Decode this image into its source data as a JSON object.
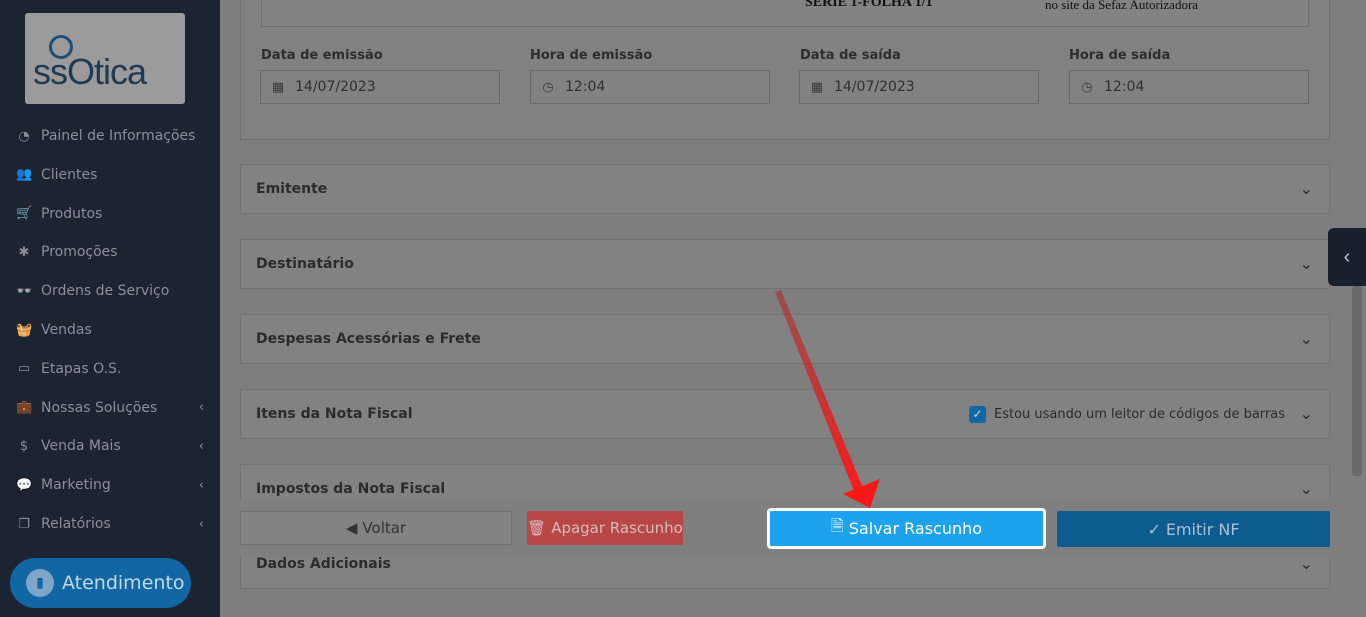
{
  "sidebar": {
    "logo_text": "ssOtica",
    "items": [
      {
        "label": "Painel de Informações",
        "icon": "dashboard-icon",
        "glyph": "◔"
      },
      {
        "label": "Clientes",
        "icon": "users-icon",
        "glyph": "👥"
      },
      {
        "label": "Produtos",
        "icon": "cart-icon",
        "glyph": "🛒"
      },
      {
        "label": "Promoções",
        "icon": "asterisk-icon",
        "glyph": "✱"
      },
      {
        "label": "Ordens de Serviço",
        "icon": "glasses-icon",
        "glyph": "👓"
      },
      {
        "label": "Vendas",
        "icon": "basket-icon",
        "glyph": "🧺"
      },
      {
        "label": "Etapas O.S.",
        "icon": "ticket-icon",
        "glyph": "▭"
      },
      {
        "label": "Nossas Soluções",
        "icon": "briefcase-icon",
        "glyph": "💼"
      },
      {
        "label": "Venda Mais",
        "icon": "dollar-icon",
        "glyph": "$"
      },
      {
        "label": "Marketing",
        "icon": "comments-icon",
        "glyph": "💬"
      },
      {
        "label": "Relatórios",
        "icon": "copy-icon",
        "glyph": "❐"
      }
    ],
    "support_button": "Atendimento"
  },
  "header_doc": {
    "serie": "SERIE 1-FOLHA 1/1",
    "site_text": "no site da Sefaz Autorizadora"
  },
  "dates": {
    "emissao_label": "Data de emissão",
    "emissao_value": "14/07/2023",
    "hora_emissao_label": "Hora de emissão",
    "hora_emissao_value": "12:04",
    "saida_label": "Data de saída",
    "saida_value": "14/07/2023",
    "hora_saida_label": "Hora de saída",
    "hora_saida_value": "12:04"
  },
  "sections": {
    "emitente": "Emitente",
    "destinatario": "Destinatário",
    "despesas": "Despesas Acessórias e Frete",
    "itens": "Itens da Nota Fiscal",
    "barcode_label": "Estou usando um leitor de códigos de barras",
    "impostos": "Impostos da Nota Fiscal",
    "dados": "Dados Adicionais"
  },
  "actions": {
    "voltar": "Voltar",
    "apagar": "Apagar Rascunho",
    "salvar": "Salvar Rascunho",
    "emitir": "Emitir NF"
  },
  "colors": {
    "salvar_bg": "#1ca3ec",
    "arrow": "#e01818"
  }
}
